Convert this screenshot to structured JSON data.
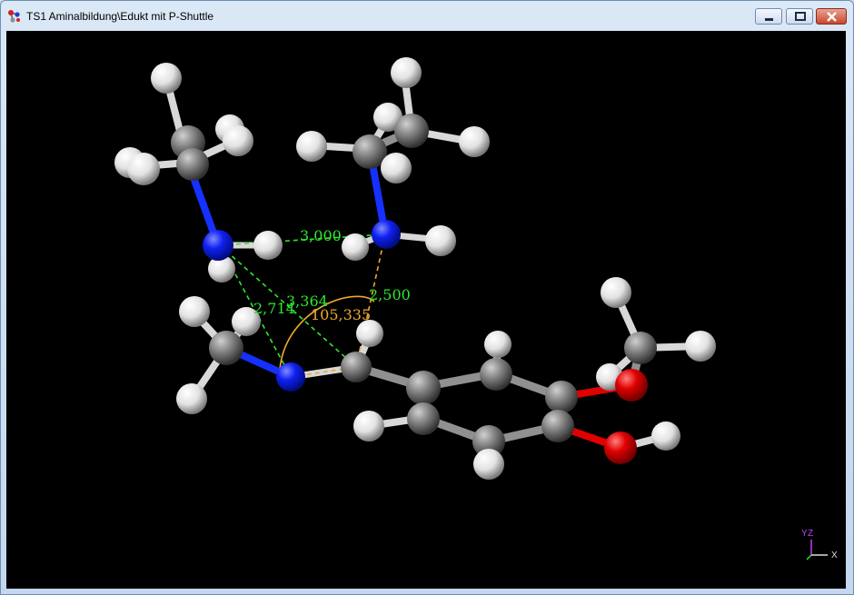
{
  "window": {
    "title": "TS1 Aminalbildung\\Edukt mit P-Shuttle",
    "controls": [
      "minimize",
      "maximize",
      "close"
    ]
  },
  "viewer": {
    "background": "#000000",
    "measurements": {
      "dist_nn": "3,000",
      "dist_2714": "2,714",
      "dist_3364": "3,364",
      "dist_2500": "2,500",
      "angle": "105,335"
    },
    "axis": {
      "y": "Y",
      "z": "Z",
      "x": "X"
    },
    "colors": {
      "distance": "#2ee82e",
      "angle": "#f0a830",
      "carbon": "#8a8a8a",
      "hydrogen": "#e8e8e8",
      "nitrogen": "#1a2cff",
      "oxygen": "#e00000"
    }
  }
}
